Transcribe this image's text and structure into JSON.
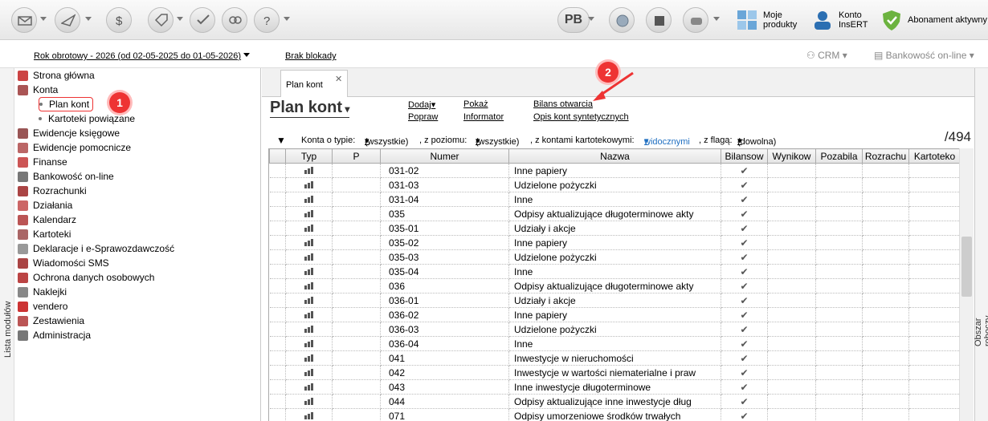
{
  "toolbar": {
    "pb_label": "PB",
    "moje_produkty": "Moje\nprodukty",
    "konto_insert": "Konto\nInsERT",
    "abonament": "Abonament aktywny"
  },
  "infobar": {
    "year": "Rok obrotowy - 2026  (od 02-05-2025 do 01-05-2026)",
    "blokada": "Brak blokady",
    "crm": "CRM",
    "bankowosc": "Bankowość on-line"
  },
  "sidebar": {
    "vertical_label": "Lista modułów",
    "items": [
      "Strona główna",
      "Konta",
      "Ewidencje księgowe",
      "Ewidencje pomocnicze",
      "Finanse",
      "Bankowość on-line",
      "Rozrachunki",
      "Działania",
      "Kalendarz",
      "Kartoteki",
      "Deklaracje i e-Sprawozdawczość",
      "Wiadomości SMS",
      "Ochrona danych osobowych",
      "Naklejki",
      "vendero",
      "Zestawienia",
      "Administracja"
    ],
    "sub_items": [
      "Plan kont",
      "Kartoteki powiązane"
    ]
  },
  "badges": {
    "one": "1",
    "two": "2"
  },
  "main": {
    "tab": "Plan kont",
    "title": "Plan kont",
    "links": {
      "dodaj": "Dodaj",
      "popraw": "Popraw",
      "pokaz": "Pokaż",
      "informator": "Informator",
      "bilans": "Bilans otwarcia",
      "opis": "Opis kont syntetycznych"
    },
    "filter": {
      "konta_label": "Konta o typie:",
      "typ": "(wszystkie)",
      "poziom_label": ", z poziomu:",
      "poziom": "(wszystkie)",
      "kart_label": ", z kontami kartotekowymi:",
      "kart": "widocznymi",
      "flaga_label": ", z flagą:",
      "flaga": "(dowolna)"
    },
    "count": "/494"
  },
  "right_panel": {
    "vertical_label": "Obszar roboczy"
  },
  "table": {
    "columns": [
      "Typ",
      "P",
      "Numer",
      "Nazwa",
      "Bilansow",
      "Wynikow",
      "Pozabila",
      "Rozrachu",
      "Kartoteko"
    ],
    "rows": [
      [
        "031-02",
        "Inne papiery"
      ],
      [
        "031-03",
        "Udzielone pożyczki"
      ],
      [
        "031-04",
        "Inne"
      ],
      [
        "035",
        "Odpisy aktualizujące długoterminowe akty"
      ],
      [
        "035-01",
        "Udziały i akcje"
      ],
      [
        "035-02",
        "Inne papiery"
      ],
      [
        "035-03",
        "Udzielone pożyczki"
      ],
      [
        "035-04",
        "Inne"
      ],
      [
        "036",
        "Odpisy aktualizujące długoterminowe akty"
      ],
      [
        "036-01",
        "Udziały i akcje"
      ],
      [
        "036-02",
        "Inne papiery"
      ],
      [
        "036-03",
        "Udzielone pożyczki"
      ],
      [
        "036-04",
        "Inne"
      ],
      [
        "041",
        "Inwestycje w nieruchomości"
      ],
      [
        "042",
        "Inwestycje w wartości niematerialne i praw"
      ],
      [
        "043",
        "Inne inwestycje długoterminowe"
      ],
      [
        "044",
        "Odpisy aktualizujące inne inwestycje dług"
      ],
      [
        "071",
        "Odpisy umorzeniowe środków trwałych"
      ]
    ],
    "check": "✔"
  }
}
